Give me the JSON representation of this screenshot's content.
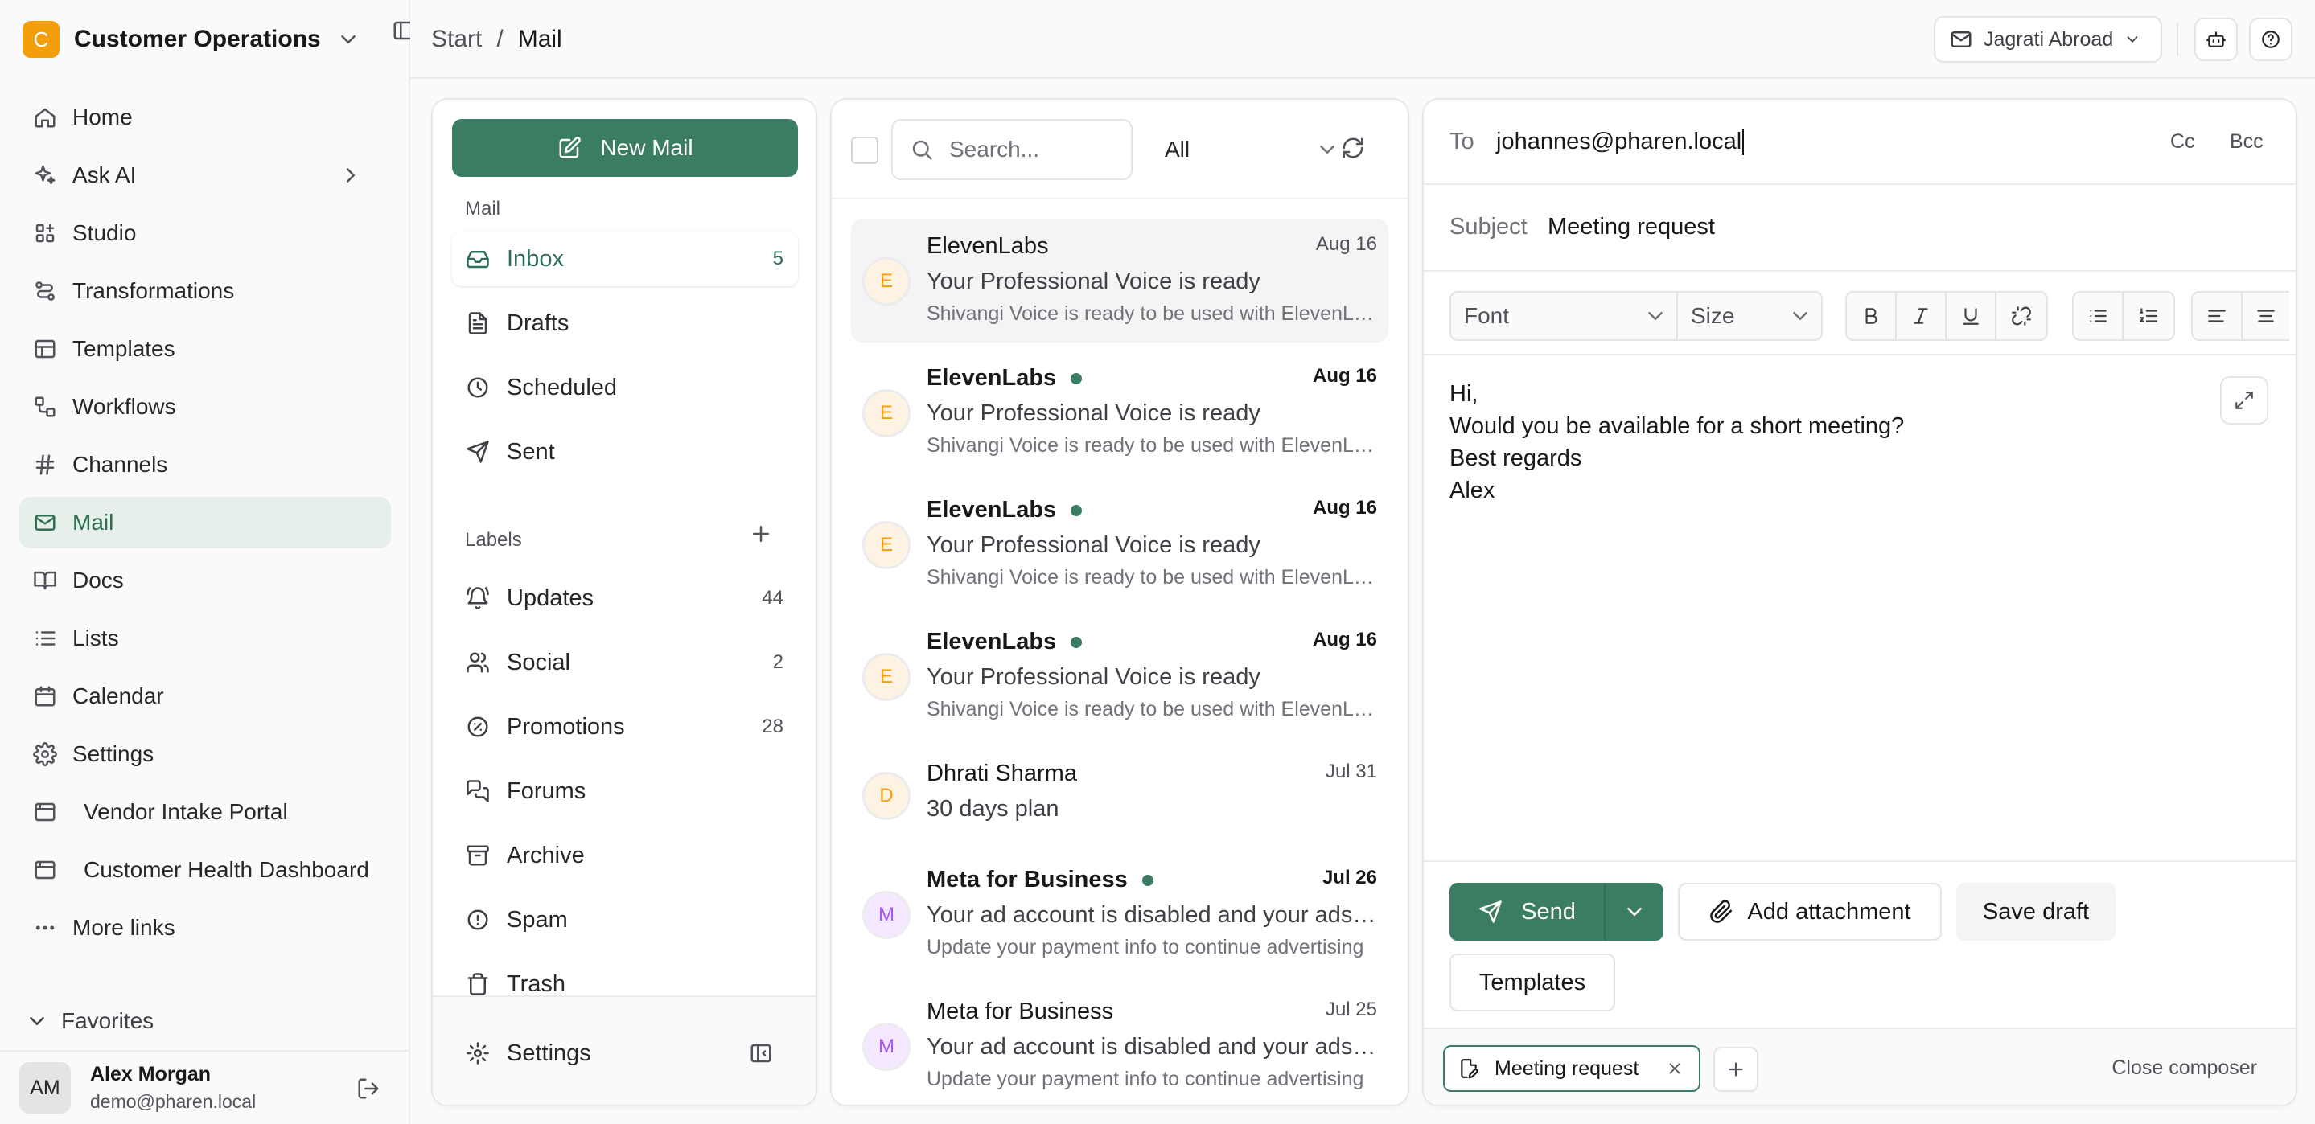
{
  "workspace": {
    "logo_letter": "C",
    "name": "Customer Operations"
  },
  "nav": {
    "home": "Home",
    "ask_ai": "Ask AI",
    "studio": "Studio",
    "transformations": "Transformations",
    "templates": "Templates",
    "workflows": "Workflows",
    "channels": "Channels",
    "mail": "Mail",
    "docs": "Docs",
    "lists": "Lists",
    "calendar": "Calendar",
    "settings": "Settings",
    "vendor_portal": "Vendor Intake Portal",
    "health_dashboard": "Customer Health Dashboard",
    "more_links": "More links",
    "favorites": "Favorites"
  },
  "user": {
    "initials": "AM",
    "name": "Alex Morgan",
    "email": "demo@pharen.local"
  },
  "breadcrumb": {
    "root": "Start",
    "separator": "/",
    "current": "Mail"
  },
  "account": {
    "name": "Jagrati Abroad"
  },
  "folders": {
    "new_mail": "New Mail",
    "section_mail": "Mail",
    "inbox": "Inbox",
    "inbox_count": "5",
    "drafts": "Drafts",
    "scheduled": "Scheduled",
    "sent": "Sent",
    "section_labels": "Labels",
    "updates": "Updates",
    "updates_count": "44",
    "social": "Social",
    "social_count": "2",
    "promotions": "Promotions",
    "promotions_count": "28",
    "forums": "Forums",
    "archive": "Archive",
    "spam": "Spam",
    "trash": "Trash",
    "settings": "Settings"
  },
  "maillist": {
    "search_placeholder": "Search...",
    "filter": "All",
    "items": [
      {
        "initial": "E",
        "from": "ElevenLabs",
        "date": "Aug 16",
        "subject": "Your Professional Voice is ready",
        "preview": "Shivangi Voice is ready to be used with ElevenLabs"
      },
      {
        "initial": "E",
        "from": "ElevenLabs",
        "date": "Aug 16",
        "subject": "Your Professional Voice is ready",
        "preview": "Shivangi Voice is ready to be used with ElevenLabs"
      },
      {
        "initial": "E",
        "from": "ElevenLabs",
        "date": "Aug 16",
        "subject": "Your Professional Voice is ready",
        "preview": "Shivangi Voice is ready to be used with ElevenLabs"
      },
      {
        "initial": "E",
        "from": "ElevenLabs",
        "date": "Aug 16",
        "subject": "Your Professional Voice is ready",
        "preview": "Shivangi Voice is ready to be used with ElevenLabs"
      },
      {
        "initial": "D",
        "from": "Dhrati Sharma",
        "date": "Jul 31",
        "subject": "30 days plan"
      },
      {
        "initial": "M",
        "from": "Meta for Business",
        "date": "Jul 26",
        "subject": "Your ad account is disabled and your ads are paused",
        "preview": "Update your payment info to continue advertising"
      },
      {
        "initial": "M",
        "from": "Meta for Business",
        "date": "Jul 25",
        "subject": "Your ad account is disabled and your ads are paused",
        "preview": "Update your payment info to continue advertising"
      }
    ]
  },
  "composer": {
    "to_label": "To",
    "to_value": "johannes@pharen.local",
    "cc": "Cc",
    "bcc": "Bcc",
    "subject_label": "Subject",
    "subject_value": "Meeting request",
    "font": "Font",
    "size": "Size",
    "body": [
      "Hi,",
      "Would you be available for a short meeting?",
      "Best regards",
      "Alex"
    ],
    "send": "Send",
    "add_attachment": "Add attachment",
    "save_draft": "Save draft",
    "templates": "Templates",
    "draft_tab": "Meeting request",
    "close_composer": "Close composer"
  }
}
